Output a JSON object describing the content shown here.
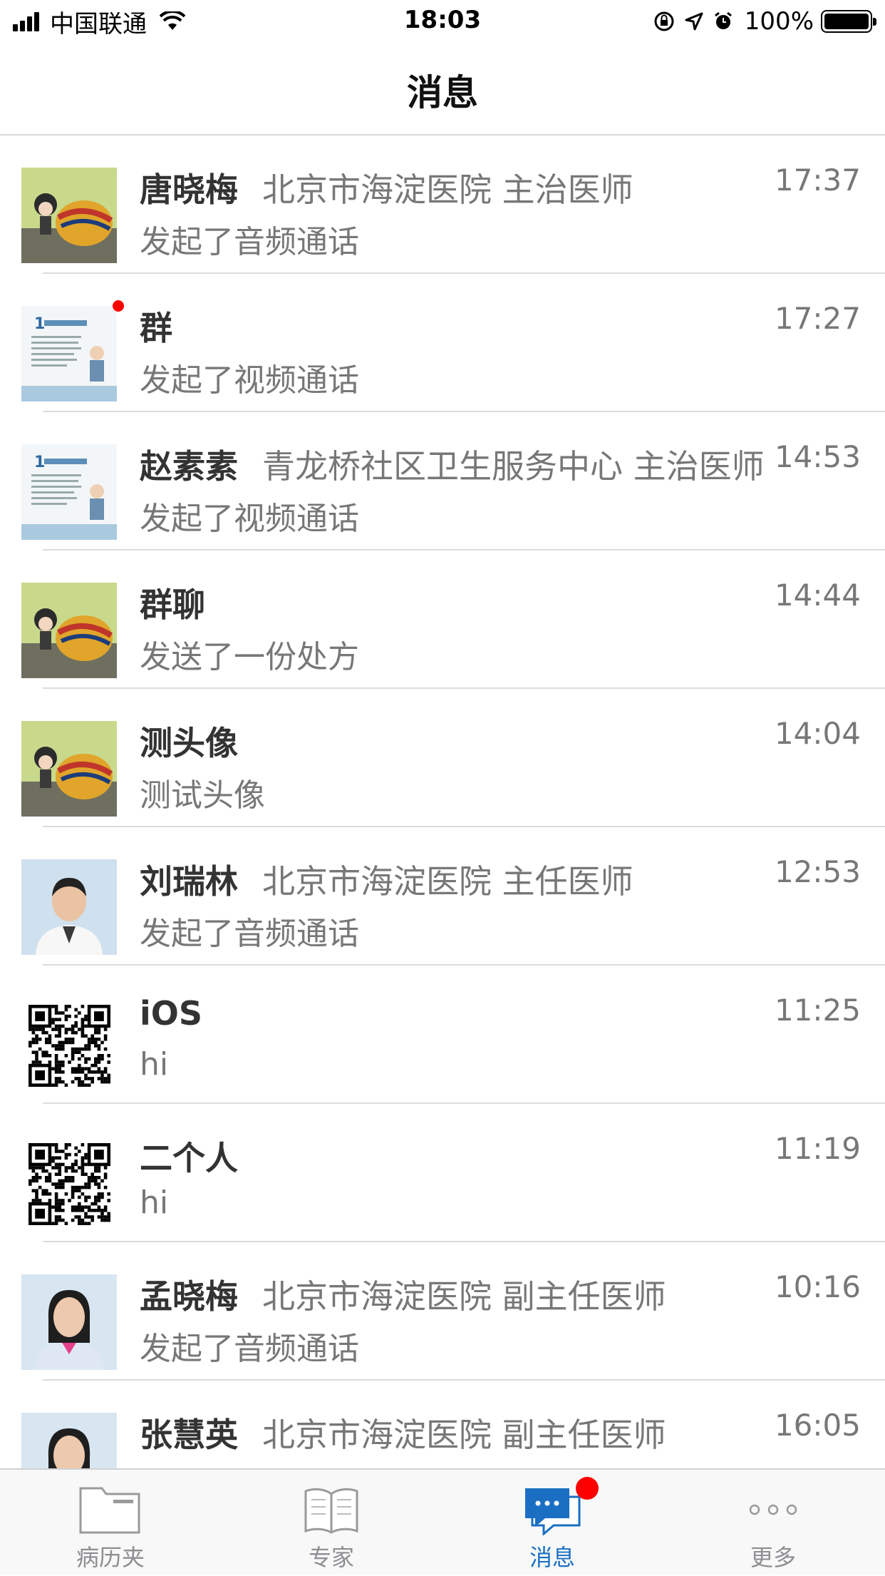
{
  "status_bar": {
    "carrier": "中国联通",
    "time": "18:03",
    "battery": "100%"
  },
  "nav": {
    "title": "消息"
  },
  "conversations": [
    {
      "avatar": "doll-helmet-photo",
      "name": "唐晓梅",
      "detail": "北京市海淀医院  主治医师",
      "time": "17:37",
      "preview": "发起了音频通话",
      "unread": false
    },
    {
      "avatar": "poster-thumbnail",
      "name": "群",
      "detail": "",
      "time": "17:27",
      "preview": "发起了视频通话",
      "unread": true
    },
    {
      "avatar": "poster-thumbnail",
      "name": "赵素素",
      "detail": "青龙桥社区卫生服务中心  主治医师",
      "time": "14:53",
      "preview": "发起了视频通话",
      "unread": false
    },
    {
      "avatar": "doll-helmet-photo",
      "name": "群聊",
      "detail": "",
      "time": "14:44",
      "preview": "发送了一份处方",
      "unread": false
    },
    {
      "avatar": "doll-helmet-photo",
      "name": "测头像",
      "detail": "",
      "time": "14:04",
      "preview": "测试头像",
      "unread": false
    },
    {
      "avatar": "doctor-photo-male",
      "name": "刘瑞林",
      "detail": "北京市海淀医院  主任医师",
      "time": "12:53",
      "preview": "发起了音频通话",
      "unread": false
    },
    {
      "avatar": "qr-code",
      "name": "iOS",
      "detail": "",
      "time": "11:25",
      "preview": "hi",
      "unread": false
    },
    {
      "avatar": "qr-code",
      "name": "二个人",
      "detail": "",
      "time": "11:19",
      "preview": "hi",
      "unread": false
    },
    {
      "avatar": "doctor-photo-female",
      "name": "孟晓梅",
      "detail": "北京市海淀医院  副主任医师",
      "time": "10:16",
      "preview": "发起了音频通话",
      "unread": false
    },
    {
      "avatar": "doctor-photo-female-2",
      "name": "张慧英",
      "detail": "北京市海淀医院  副主任医师",
      "time": "16:05",
      "preview": "",
      "unread": false
    }
  ],
  "tabs": [
    {
      "label": "病历夹",
      "icon": "folder-icon",
      "active": false
    },
    {
      "label": "专家",
      "icon": "book-icon",
      "active": false
    },
    {
      "label": "消息",
      "icon": "chat-bubble-icon",
      "active": true,
      "badge": true
    },
    {
      "label": "更多",
      "icon": "more-dots-icon",
      "active": false
    }
  ],
  "colors": {
    "accent": "#1a6fc2",
    "badge": "#ff0000",
    "secondary_text": "#777777"
  }
}
